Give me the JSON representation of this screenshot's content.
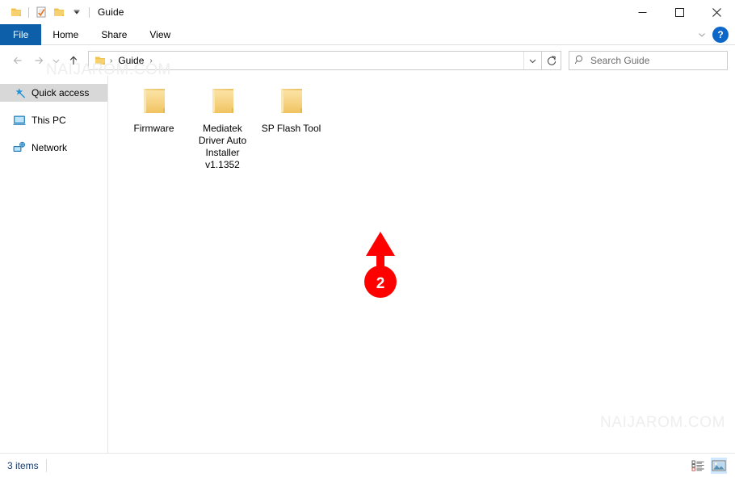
{
  "window": {
    "title": "Guide",
    "quick_access_toolbar": [
      {
        "name": "folder-icon",
        "label": "Folder"
      },
      {
        "name": "properties-icon",
        "label": "Properties"
      },
      {
        "name": "new-folder-icon",
        "label": "New folder"
      },
      {
        "name": "chevron-down-icon",
        "label": "Customize Quick Access Toolbar"
      }
    ],
    "controls": {
      "minimize": "—",
      "maximize": "□",
      "close": "✕"
    }
  },
  "ribbon": {
    "tabs": [
      {
        "label": "File",
        "active": true
      },
      {
        "label": "Home",
        "active": false
      },
      {
        "label": "Share",
        "active": false
      },
      {
        "label": "View",
        "active": false
      }
    ],
    "collapse_label": "∨",
    "help_label": "?"
  },
  "address_bar": {
    "back_label": "←",
    "forward_label": "→",
    "recent_label": "∨",
    "up_label": "↑",
    "breadcrumb": [
      {
        "label": "Guide"
      }
    ],
    "separator": "›",
    "dropdown_label": "∨",
    "refresh_label": "↻"
  },
  "search": {
    "placeholder": "Search Guide",
    "value": "",
    "icon": "search-icon"
  },
  "sidebar": {
    "items": [
      {
        "label": "Quick access",
        "icon": "star-pin-icon",
        "selected": true
      },
      {
        "label": "This PC",
        "icon": "monitor-icon",
        "selected": false
      },
      {
        "label": "Network",
        "icon": "network-icon",
        "selected": false
      }
    ]
  },
  "main": {
    "items": [
      {
        "label": "Firmware",
        "type": "folder"
      },
      {
        "label": "Mediatek Driver Auto Installer v1.1352",
        "type": "folder"
      },
      {
        "label": "SP Flash Tool",
        "type": "folder"
      }
    ]
  },
  "annotation": {
    "number": "2",
    "color": "#FF0000",
    "points_to": "SP Flash Tool"
  },
  "watermarks": [
    {
      "text": "NAIJAROM.COM",
      "position": "top-left"
    },
    {
      "text": "NAIJAROM.COM",
      "position": "bottom-right"
    }
  ],
  "status_bar": {
    "item_count": "3 items",
    "views": [
      {
        "name": "details-view-button",
        "label": "Details view",
        "active": false
      },
      {
        "name": "large-icons-view-button",
        "label": "Large icons view",
        "active": true
      }
    ]
  },
  "colors": {
    "ribbon_file_tab": "#0d5faa",
    "annotation_red": "#FF0000",
    "folder_yellow": "#F6D67C",
    "selection_blue": "#cde8ff"
  }
}
